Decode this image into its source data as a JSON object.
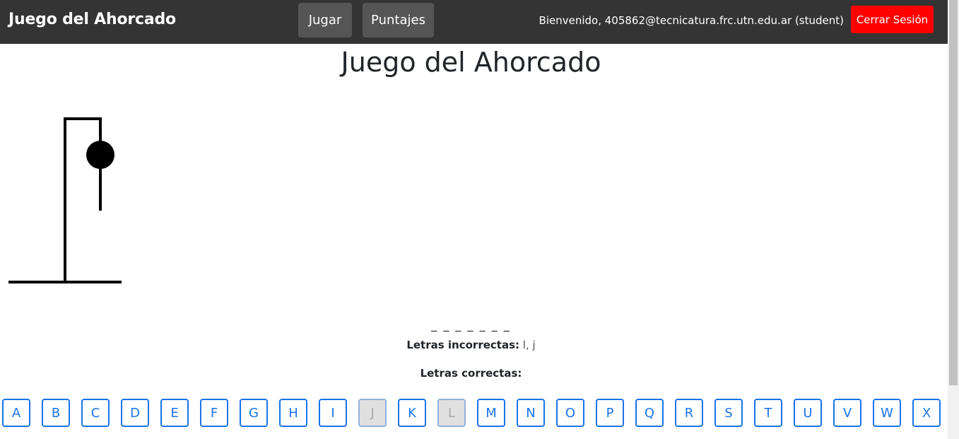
{
  "navbar": {
    "brand": "Juego del Ahorcado",
    "links": [
      {
        "label": "Jugar"
      },
      {
        "label": "Puntajes"
      }
    ],
    "welcome": "Bienvenido, 405862@tecnicatura.frc.utn.edu.ar (student)",
    "logout_label": "Cerrar Sesión",
    "colors": {
      "background": "#343434",
      "button": "#555555",
      "logout": "#ff0000"
    }
  },
  "game": {
    "title": "Juego del Ahorcado",
    "word_display": "_ _ _ _ _ _ _",
    "wrong_label": "Letras incorrectas:",
    "wrong_value": "l, j",
    "correct_label": "Letras correctas:",
    "correct_value": "",
    "errors": 2,
    "letters": [
      {
        "label": "A",
        "used": false
      },
      {
        "label": "B",
        "used": false
      },
      {
        "label": "C",
        "used": false
      },
      {
        "label": "D",
        "used": false
      },
      {
        "label": "E",
        "used": false
      },
      {
        "label": "F",
        "used": false
      },
      {
        "label": "G",
        "used": false
      },
      {
        "label": "H",
        "used": false
      },
      {
        "label": "I",
        "used": false
      },
      {
        "label": "J",
        "used": true
      },
      {
        "label": "K",
        "used": false
      },
      {
        "label": "L",
        "used": true
      },
      {
        "label": "M",
        "used": false
      },
      {
        "label": "N",
        "used": false
      },
      {
        "label": "O",
        "used": false
      },
      {
        "label": "P",
        "used": false
      },
      {
        "label": "Q",
        "used": false
      },
      {
        "label": "R",
        "used": false
      },
      {
        "label": "S",
        "used": false
      },
      {
        "label": "T",
        "used": false
      },
      {
        "label": "U",
        "used": false
      },
      {
        "label": "V",
        "used": false
      },
      {
        "label": "W",
        "used": false
      },
      {
        "label": "X",
        "used": false
      }
    ],
    "accent_color": "#1a73e8"
  }
}
